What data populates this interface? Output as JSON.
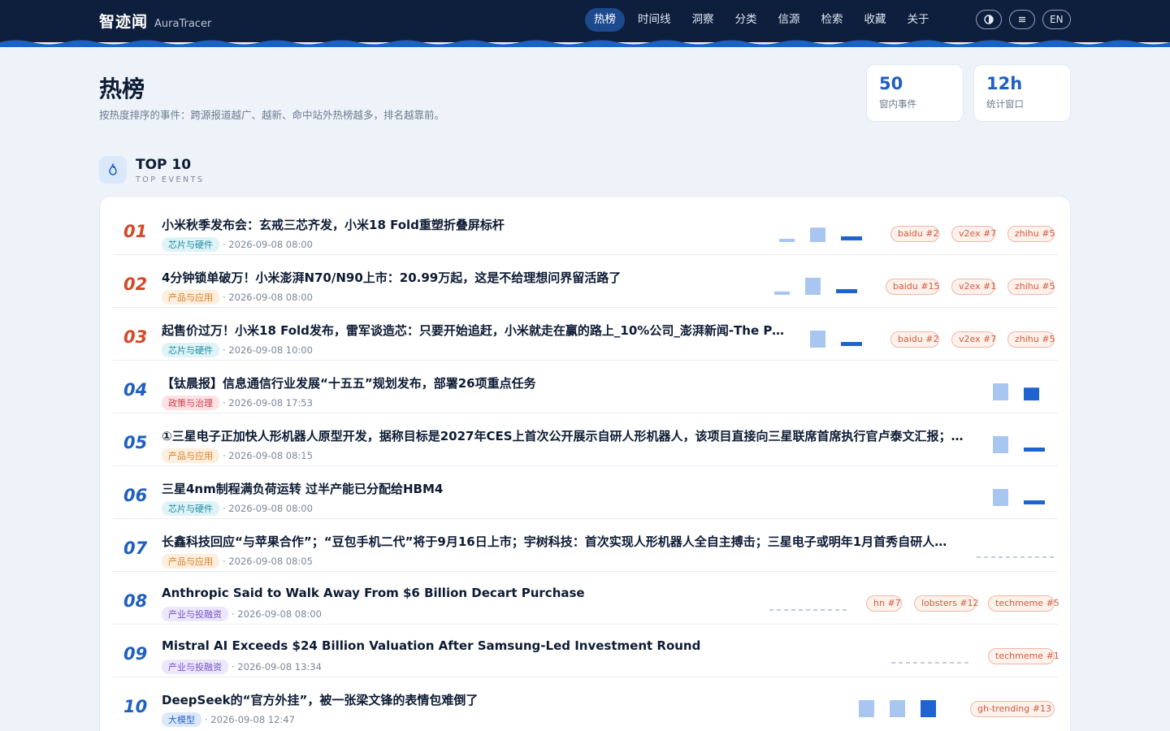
{
  "header": {
    "brand_cn": "智迹闻",
    "brand_en": "AuraTracer",
    "nav": [
      "热榜",
      "时间线",
      "洞察",
      "分类",
      "信源",
      "检索",
      "收藏",
      "关于"
    ],
    "active_nav": "热榜",
    "tools": {
      "theme_icon": "contrast-icon",
      "menu_icon": "menu-icon",
      "lang": "EN"
    }
  },
  "page": {
    "title": "热榜",
    "subtitle": "按热度排序的事件：跨源报道越广、越新、命中站外热榜越多，排名越靠前。",
    "stats": [
      {
        "value": "50",
        "label": "窗内事件"
      },
      {
        "value": "12h",
        "label": "统计窗口"
      }
    ]
  },
  "section": {
    "icon": "flame-icon",
    "title": "TOP 10",
    "subtitle": "TOP EVENTS"
  },
  "colors": {
    "accent": "#1f5fbf",
    "hot_rank": "#d24a2a",
    "header_bg": "#0e1f3d",
    "source_tag": "#d25b3c"
  },
  "events": [
    {
      "rank": "01",
      "title": "小米秋季发布会：玄戒三芯齐发，小米18 Fold重塑折叠屏标杆",
      "category": "芯片与硬件",
      "cat_type": "chip",
      "time": "· 2026-09-08 08:00",
      "trend": [
        0.15,
        0.85,
        0.35
      ],
      "sources": [
        "baidu #2",
        "v2ex #7",
        "zhihu #5"
      ]
    },
    {
      "rank": "02",
      "title": "4分钟锁单破万！小米澎湃N70/N90上市：20.99万起，这是不给理想问界留活路了",
      "category": "产品与应用",
      "cat_type": "prod",
      "time": "· 2026-09-08 08:00",
      "trend": [
        0.2,
        1.0,
        0.25
      ],
      "sources": [
        "baidu #15",
        "v2ex #1",
        "zhihu #5"
      ]
    },
    {
      "rank": "03",
      "title": "起售价过万！小米18 Fold发布，雷军谈造芯：只要开始追赶，小米就走在赢的路上_10%公司_澎湃新闻-The Paper",
      "category": "芯片与硬件",
      "cat_type": "chip",
      "time": "· 2026-09-08 10:00",
      "trend": [
        1.0,
        0.25
      ],
      "sources": [
        "baidu #2",
        "v2ex #7",
        "zhihu #5"
      ]
    },
    {
      "rank": "04",
      "title": "【钛晨报】信息通信行业发展“十五五”规划发布，部署26项重点任务",
      "category": "政策与治理",
      "cat_type": "policy",
      "time": "· 2026-09-08 17:53",
      "trend": [
        1.0,
        0.75
      ],
      "sources": []
    },
    {
      "rank": "05",
      "title": "①三星电子正加快人形机器人原型开发，据称目标是2027年CES上首次公开展示自研人形机器人，该项目直接向三星联席首席执行官卢泰文汇报；②…",
      "category": "产品与应用",
      "cat_type": "prod",
      "time": "· 2026-09-08 08:15",
      "trend": [
        1.0,
        0.4
      ],
      "sources": []
    },
    {
      "rank": "06",
      "title": "三星4nm制程满负荷运转 过半产能已分配给HBM4",
      "category": "芯片与硬件",
      "cat_type": "chip",
      "time": "· 2026-09-08 08:00",
      "trend": [
        1.0,
        0.25
      ],
      "sources": []
    },
    {
      "rank": "07",
      "title": "长鑫科技回应“与苹果合作”；“豆包手机二代”将于9月16日上市；宇树科技：首次实现人形机器人全自主搏击；三星电子或明年1月首秀自研人形机器人",
      "category": "产品与应用",
      "cat_type": "prod",
      "time": "· 2026-09-08 08:05",
      "trend": [],
      "sources": []
    },
    {
      "rank": "08",
      "title": "Anthropic Said to Walk Away From $6 Billion Decart Purchase",
      "category": "产业与投融资",
      "cat_type": "ind",
      "time": "· 2026-09-08 08:00",
      "trend": [],
      "sources": [
        "hn #7",
        "lobsters #12",
        "techmeme #5"
      ]
    },
    {
      "rank": "09",
      "title": "Mistral AI Exceeds $24 Billion Valuation After Samsung-Led Investment Round",
      "category": "产业与投融资",
      "cat_type": "ind",
      "time": "· 2026-09-08 13:34",
      "trend": [],
      "sources": [
        "techmeme #1"
      ]
    },
    {
      "rank": "10",
      "title": "DeepSeek的“官方外挂”，被一张梁文锋的表情包难倒了",
      "category": "大模型",
      "cat_type": "llm",
      "time": "· 2026-09-08 12:47",
      "trend": [
        1.0,
        1.0,
        1.0
      ],
      "sources": [
        "gh-trending #13"
      ]
    }
  ]
}
